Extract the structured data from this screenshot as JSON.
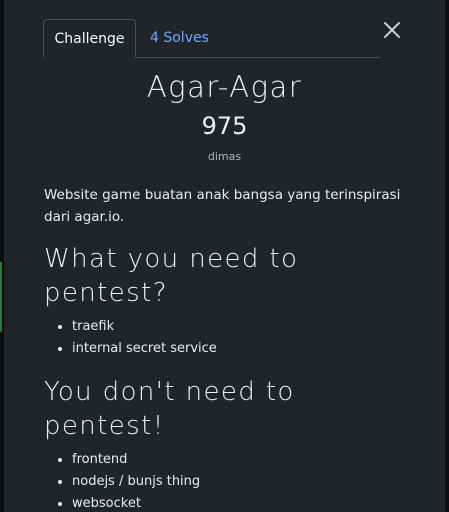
{
  "tabs": {
    "challenge": "Challenge",
    "solves": "4 Solves"
  },
  "challenge": {
    "name": "Agar-Agar",
    "points": "975",
    "author": "dimas",
    "description": "Website game buatan anak bangsa yang terinspirasi dari agar.io."
  },
  "sections": [
    {
      "heading": "What you need to pentest?",
      "items": [
        "traefik",
        "internal secret service"
      ]
    },
    {
      "heading": "You don't need to pentest!",
      "items": [
        "frontend",
        "nodejs / bunjs thing",
        "websocket"
      ]
    }
  ],
  "colors": {
    "modal_background": "#212529",
    "tab_link": "#6ea8fe",
    "side_accent": "#2f7a3a"
  },
  "icons": {
    "close": "close-icon"
  }
}
